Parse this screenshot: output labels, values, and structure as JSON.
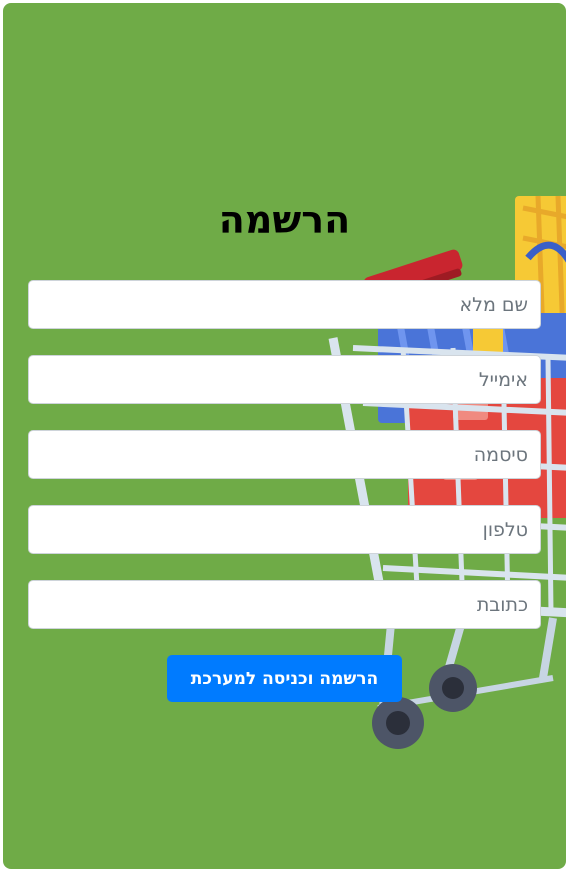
{
  "form": {
    "title": "הרשמה",
    "fields": {
      "full_name": {
        "placeholder": "שם מלא",
        "value": ""
      },
      "email": {
        "placeholder": "אימייל",
        "value": ""
      },
      "password": {
        "placeholder": "סיסמה",
        "value": ""
      },
      "phone": {
        "placeholder": "טלפון",
        "value": ""
      },
      "address": {
        "placeholder": "כתובת",
        "value": ""
      }
    },
    "submit_label": "הרשמה וכניסה למערכת"
  },
  "colors": {
    "background": "#6fab47",
    "button": "#007bff",
    "button_text": "#ffffff"
  },
  "illustration": "shopping-cart-illustration"
}
